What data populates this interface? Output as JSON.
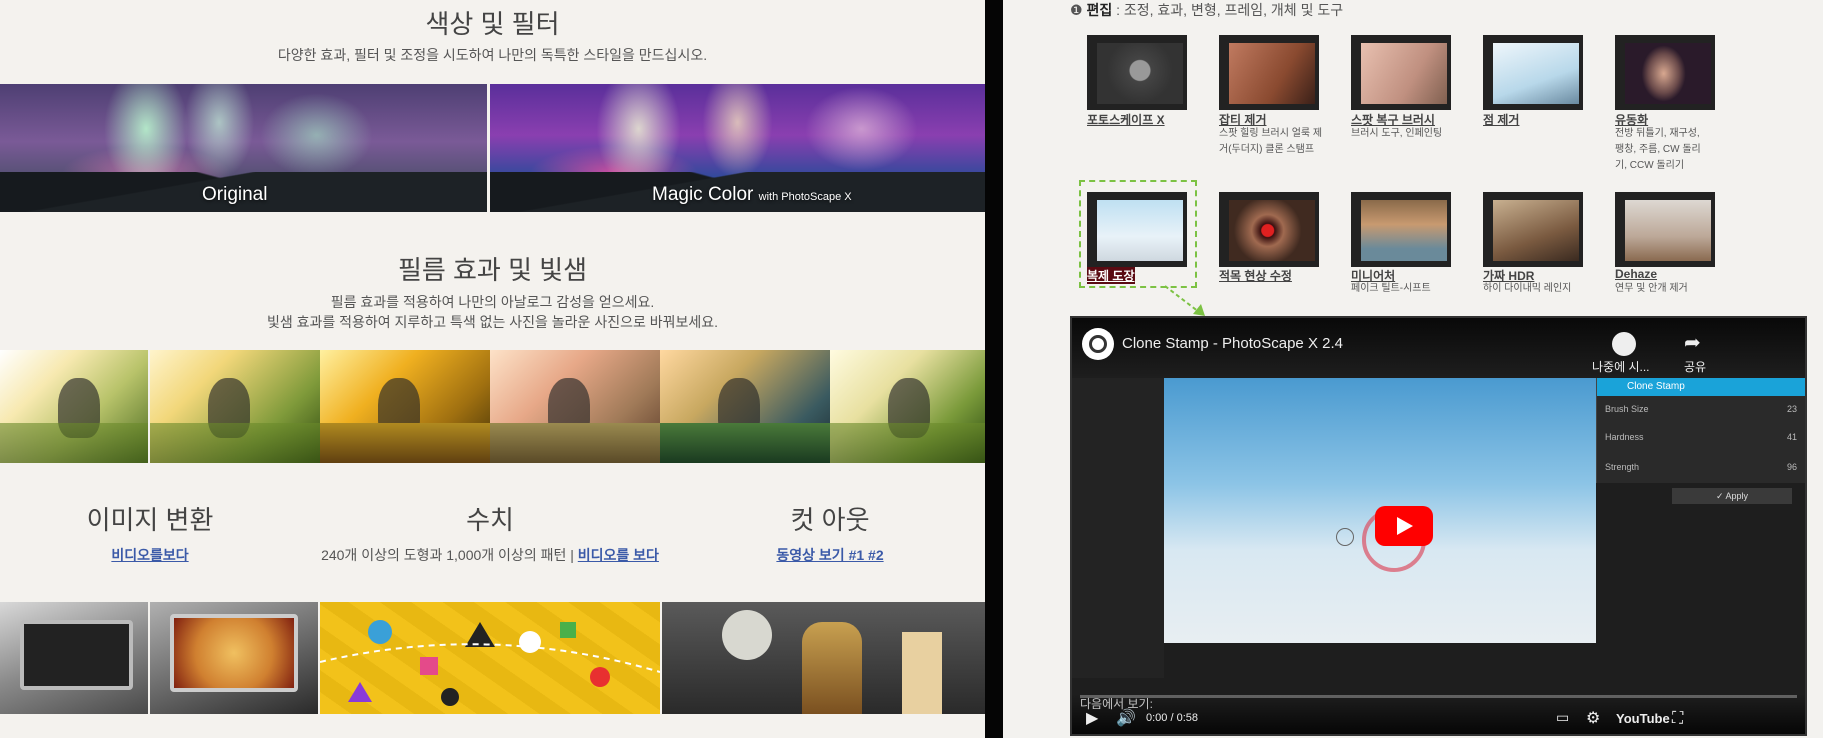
{
  "left": {
    "section1": {
      "title": "색상 및 필터",
      "subtitle": "다양한 효과, 필터 및 조정을 시도하여 나만의 독특한 스타일을 만드십시오.",
      "caption_original": "Original",
      "caption_magic": "Magic Color",
      "caption_magic_small": "with PhotoScape X"
    },
    "section2": {
      "title": "필름 효과 및 빛샘",
      "line1": "필름 효과를 적용하여 나만의 아날로그 감성을 얻으세요.",
      "line2": "빛샘 효과를 적용하여 지루하고 특색 없는 사진을 놀라운 사진으로 바꿔보세요."
    },
    "columns": [
      {
        "title": "이미지 변환",
        "link": "비디오를보다"
      },
      {
        "title": "수치",
        "text": "240개 이상의 도형과 1,000개 이상의 패턴 |",
        "link": "비디오를 보다"
      },
      {
        "title": "컷 아웃",
        "link": "동영상 보기 #1 #2"
      }
    ]
  },
  "right": {
    "breadcrumb_bold": "편집",
    "breadcrumb_rest": " : 조정, 효과, 변형, 프레임, 개체 및 도구",
    "row1": [
      {
        "label": "포토스케이프 X",
        "desc": ""
      },
      {
        "label": "잡티 제거",
        "desc": "스팟 힐링 브러시 얼룩 제거(두더지) 클론 스탬프"
      },
      {
        "label": "스팟 복구 브러시",
        "desc": "브러시 도구, 인페인팅"
      },
      {
        "label": "점 제거",
        "desc": ""
      },
      {
        "label": "유동화",
        "desc": "전방 뒤틀기, 재구성, 팽창, 주름, CW 돌리기, CCW 돌리기"
      }
    ],
    "row2": [
      {
        "label": "복제 도장",
        "desc": ""
      },
      {
        "label": "적목 현상 수정",
        "desc": ""
      },
      {
        "label": "미니어처",
        "desc": "페이크 틸트-시프트"
      },
      {
        "label": "가짜 HDR",
        "desc": "하이 다이내믹 레인지"
      },
      {
        "label": "Dehaze",
        "desc": "연무 및 안개 제거"
      }
    ],
    "video": {
      "title": "Clone Stamp - PhotoScape X 2.4",
      "watch_later": "나중에 시...",
      "share": "공유",
      "panel_title": "Clone Stamp",
      "brush_size_label": "Brush Size",
      "brush_size_value": "23",
      "hardness_label": "Hardness",
      "hardness_value": "41",
      "strength_label": "Strength",
      "strength_value": "96",
      "apply_label": "✓ Apply",
      "more_videos": "다음에서 보기:",
      "time": "0:00 / 0:58",
      "youtube": "YouTube",
      "progress": 0
    }
  },
  "colors": {
    "link": "#3b5aa8",
    "highlight_border": "#7cc243",
    "youtube_red": "#ff0000",
    "panel_accent": "#1aa3d9"
  }
}
